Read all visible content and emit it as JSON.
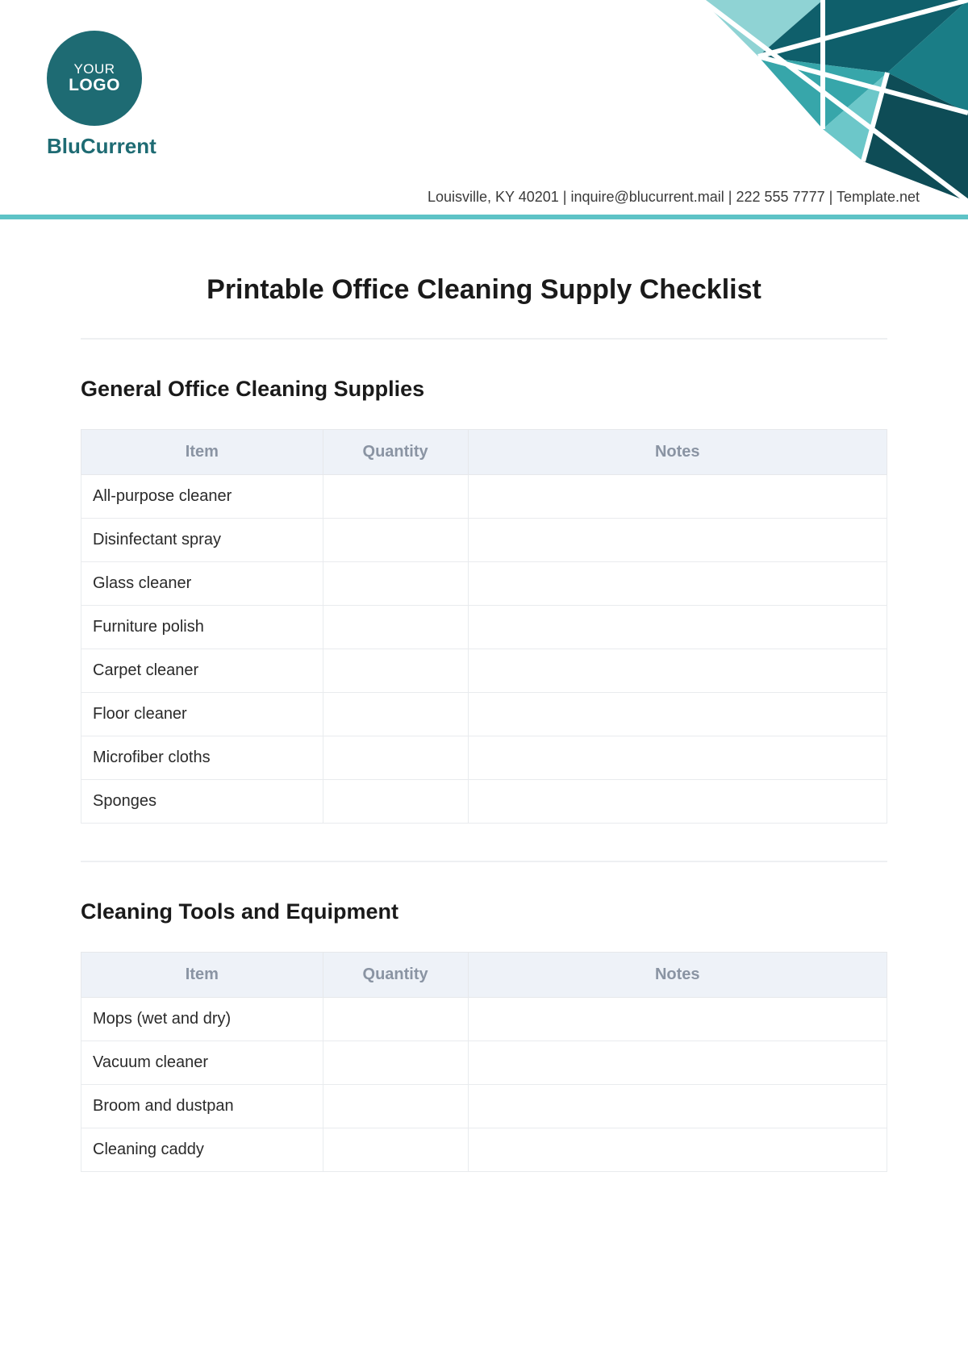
{
  "brand": {
    "logo_line1": "YOUR",
    "logo_line2": "LOGO",
    "name": "BluCurrent",
    "contact": "Louisville, KY 40201 | inquire@blucurrent.mail | 222 555 7777 | Template.net"
  },
  "title": "Printable Office Cleaning Supply Checklist",
  "columns": {
    "item": "Item",
    "qty": "Quantity",
    "notes": "Notes"
  },
  "sections": [
    {
      "heading": "General Office Cleaning Supplies",
      "rows": [
        {
          "item": "All-purpose cleaner",
          "qty": "",
          "notes": ""
        },
        {
          "item": "Disinfectant spray",
          "qty": "",
          "notes": ""
        },
        {
          "item": "Glass cleaner",
          "qty": "",
          "notes": ""
        },
        {
          "item": "Furniture polish",
          "qty": "",
          "notes": ""
        },
        {
          "item": "Carpet cleaner",
          "qty": "",
          "notes": ""
        },
        {
          "item": "Floor cleaner",
          "qty": "",
          "notes": ""
        },
        {
          "item": "Microfiber cloths",
          "qty": "",
          "notes": ""
        },
        {
          "item": "Sponges",
          "qty": "",
          "notes": ""
        }
      ]
    },
    {
      "heading": "Cleaning Tools and Equipment",
      "rows": [
        {
          "item": "Mops (wet and dry)",
          "qty": "",
          "notes": ""
        },
        {
          "item": "Vacuum cleaner",
          "qty": "",
          "notes": ""
        },
        {
          "item": "Broom and dustpan",
          "qty": "",
          "notes": ""
        },
        {
          "item": "Cleaning caddy",
          "qty": "",
          "notes": ""
        }
      ]
    }
  ]
}
